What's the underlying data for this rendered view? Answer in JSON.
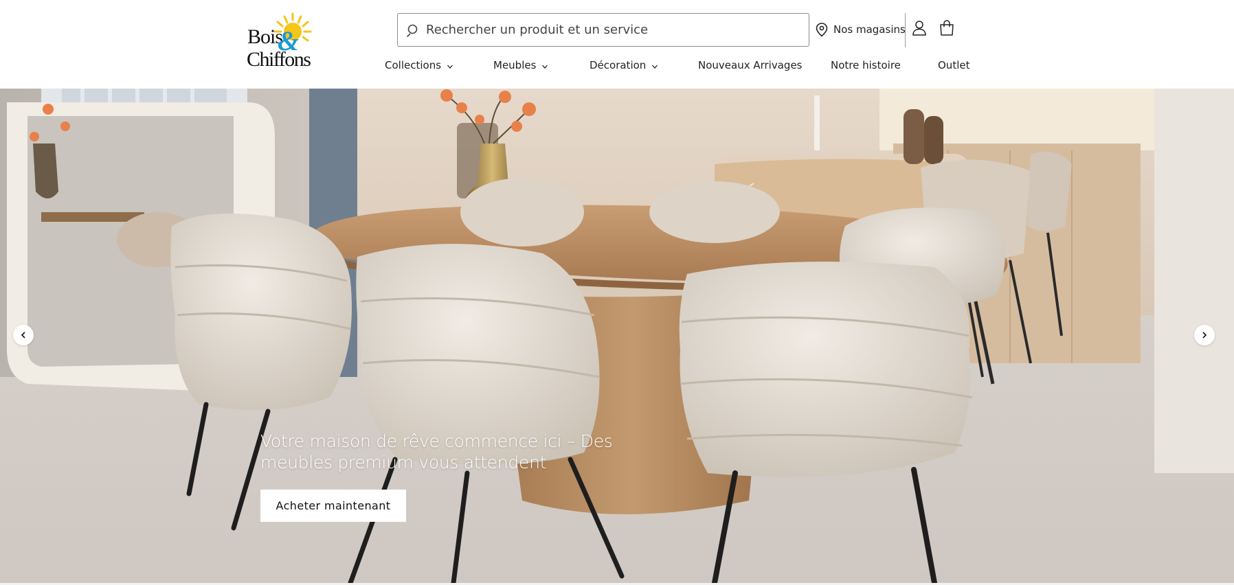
{
  "brand": {
    "logo_alt": "Bois & Chiffons",
    "logo_line1": "Bois",
    "logo_amp": "&",
    "logo_line2": "Chiffons"
  },
  "search": {
    "placeholder": "Rechercher un produit et un service"
  },
  "header": {
    "stores_label": "Nos magasins"
  },
  "nav": {
    "collections": "Collections",
    "meubles": "Meubles",
    "decoration": "Décoration",
    "nouveaux": "Nouveaux Arrivages",
    "histoire": "Notre histoire",
    "outlet": "Outlet"
  },
  "hero": {
    "headline": "Votre maison de rêve commence ici – Des meubles premium vous attendent",
    "cta_label": "Acheter maintenant"
  },
  "icons": {
    "search": "search-icon",
    "stores": "map-pin-icon",
    "account": "user-icon",
    "cart": "shopping-bag-icon",
    "dropdown": "chevron-down-icon",
    "prev": "chevron-left-icon",
    "next": "chevron-right-icon"
  },
  "colors": {
    "sun": "#f5c518",
    "ampersand": "#1a9ad6",
    "text": "#222222",
    "cta_bg": "#ffffff"
  }
}
